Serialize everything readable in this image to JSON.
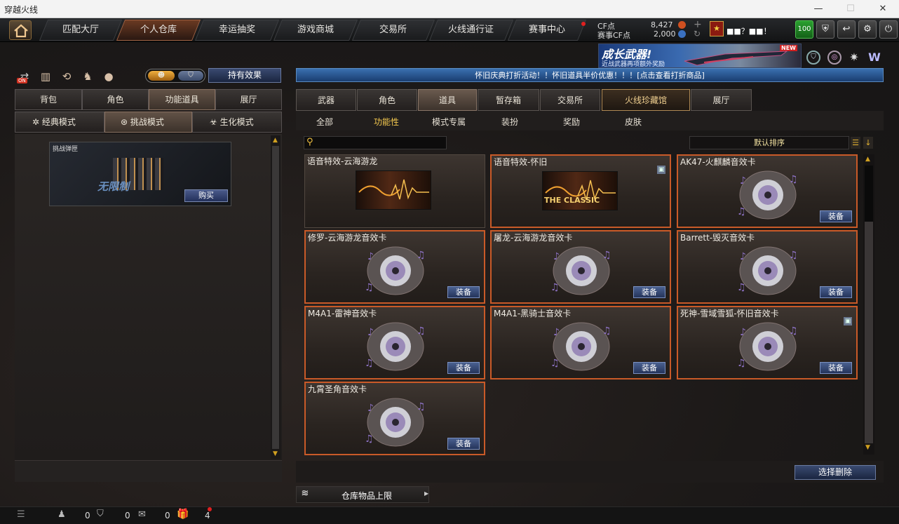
{
  "window": {
    "title": "穿越火线",
    "minimize": "—",
    "maximize": "☐",
    "close": "✕"
  },
  "nav": {
    "tabs": [
      {
        "label": "匹配大厅"
      },
      {
        "label": "个人仓库",
        "active": true
      },
      {
        "label": "幸运抽奖"
      },
      {
        "label": "游戏商城"
      },
      {
        "label": "交易所"
      },
      {
        "label": "火线通行证"
      },
      {
        "label": "赛事中心"
      }
    ],
    "cf_label": "CF点",
    "cf_value": "8,427",
    "match_cf_label": "赛事CF点",
    "match_cf_value": "2,000",
    "player_name": "■■？■■！",
    "level": "100"
  },
  "promo": {
    "title": "成长武器!",
    "subtitle": "近战武器再项额外奖励",
    "badge": "NEW"
  },
  "left": {
    "toggle_on": "ON",
    "effects_button": "持有效果",
    "tabs": [
      "背包",
      "角色",
      "功能道具",
      "展厅"
    ],
    "active_tab": 2,
    "modes": [
      "经典模式",
      "挑战模式",
      "生化模式"
    ],
    "active_mode": 1,
    "card": {
      "title": "挑战弹匣",
      "caption": "无限制",
      "buy": "购买"
    }
  },
  "right": {
    "notice": "怀旧庆典打折活动！！怀旧道具半价优惠！！！[点击查看打折商品]",
    "tabs": [
      "武器",
      "角色",
      "道具",
      "暂存箱",
      "交易所",
      "火线珍藏馆",
      "展厅"
    ],
    "active_tab": 2,
    "subtabs": [
      "全部",
      "功能性",
      "模式专属",
      "装扮",
      "奖励",
      "皮肤"
    ],
    "active_subtab": 1,
    "search_placeholder": "",
    "sort_label": "默认排序",
    "items": [
      {
        "name": "语音特效-云海游龙",
        "type": "banner",
        "equip": ""
      },
      {
        "name": "语音特效-怀旧",
        "type": "banner",
        "equip": "",
        "banner_text": "THE CLASSIC"
      },
      {
        "name": "AK47-火麒麟音效卡",
        "type": "disc",
        "equip": "装备"
      },
      {
        "name": "修罗-云海游龙音效卡",
        "type": "disc",
        "equip": "装备"
      },
      {
        "name": "屠龙-云海游龙音效卡",
        "type": "disc",
        "equip": "装备"
      },
      {
        "name": "Barrett-毁灭音效卡",
        "type": "disc",
        "equip": "装备"
      },
      {
        "name": "M4A1-雷神音效卡",
        "type": "disc",
        "equip": "装备"
      },
      {
        "name": "M4A1-黑骑士音效卡",
        "type": "disc",
        "equip": "装备"
      },
      {
        "name": "死神-雪域雪狐-怀旧音效卡",
        "type": "disc",
        "equip": "装备"
      },
      {
        "name": "九霄圣角音效卡",
        "type": "disc",
        "equip": "装备"
      }
    ],
    "delete_button": "选择删除",
    "capacity_label": "仓库物品上限"
  },
  "status": {
    "friends": "0",
    "shield": "0",
    "messages": "0",
    "gifts": "4"
  }
}
